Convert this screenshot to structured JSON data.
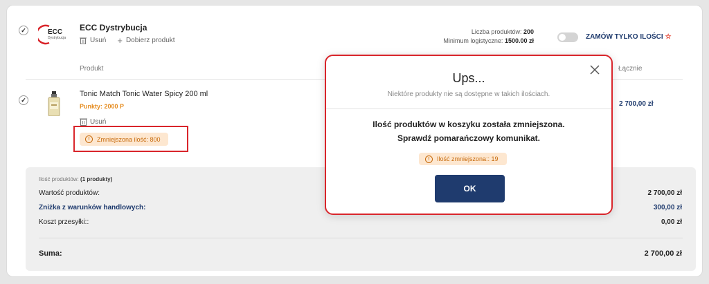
{
  "vendor": {
    "logo_main": "ECC",
    "logo_sub": "Dystrybucja",
    "name": "ECC Dystrybucja",
    "remove_label": "Usuń",
    "add_product_label": "Dobierz produkt",
    "product_count_label": "Liczba produktów:",
    "product_count_value": "200",
    "min_logistic_label": "Minimum logistyczne:",
    "min_logistic_value": "1500.00 zł",
    "order_only_label": "ZAMÓW TYLKO ILOŚCI",
    "order_only_star": "☆",
    "order_only_enabled": false
  },
  "table": {
    "col_product": "Produkt",
    "col_total": "Łącznie"
  },
  "product": {
    "checked": true,
    "name": "Tonic Match Tonic Water Spicy 200 ml",
    "points": "Punkty: 2000 P",
    "remove_label": "Usuń",
    "total": "2 700,00 zł",
    "reduced_qty": "Zmniejszona ilość: 800"
  },
  "totals": {
    "count_label": "Ilość produktów:",
    "count_value": "(1 produkty)",
    "value_label": "Wartość produktów:",
    "value_amount": "2 700,00 zł",
    "discount_label": "Zniżka z warunków handlowych:",
    "discount_amount": "300,00 zł",
    "shipping_label": "Koszt przesyłki::",
    "shipping_amount": "0,00 zł",
    "sum_label": "Suma:",
    "sum_amount": "2 700,00 zł"
  },
  "modal": {
    "title": "Ups...",
    "subtitle": "Niektóre produkty nie są dostępne w takich ilościach.",
    "message_line1": "Ilość produktów w koszyku została zmniejszona.",
    "message_line2": "Sprawdź pomarańczowy komunikat.",
    "badge": "Ilość zmniejszona:: 19",
    "ok_label": "OK"
  },
  "colors": {
    "brand_navy": "#1f3b6e",
    "warning_orange": "#c76a0b",
    "warning_bg": "#fde7d0",
    "highlight_red": "#d9252b",
    "points_orange": "#e58b1e"
  }
}
